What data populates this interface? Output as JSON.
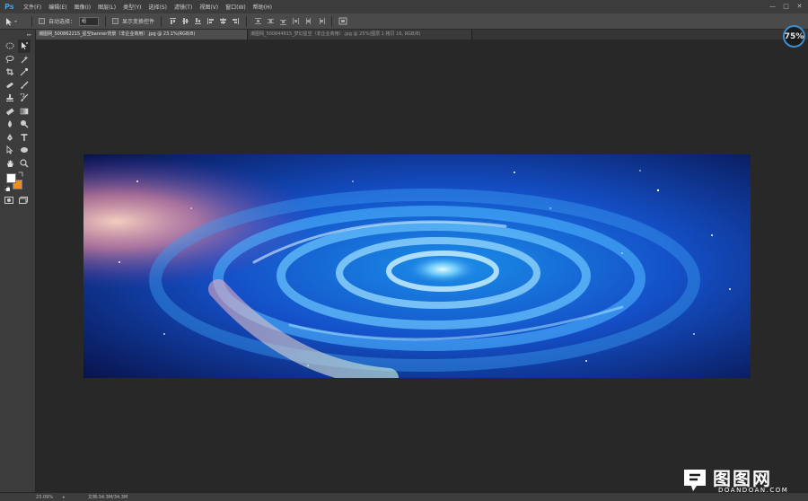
{
  "app": {
    "logo": "Ps"
  },
  "menubar": {
    "items": [
      "文件(F)",
      "编辑(E)",
      "图像(I)",
      "图层(L)",
      "类型(Y)",
      "选择(S)",
      "滤镜(T)",
      "视图(V)",
      "窗口(W)",
      "帮助(H)"
    ]
  },
  "options": {
    "auto_select_label": "自动选择：",
    "auto_select_value": "组",
    "show_transform_label": "显示变换控件"
  },
  "zoom_gauge": {
    "label": "75%"
  },
  "tabs": [
    {
      "label": "潮图网_500862215_星空banner背景（非企业商用）.jpg @ 23.1%(RGB/8)",
      "active": true
    },
    {
      "label": "潮图网_500844815_梦幻星空（非企业商用）.jpg @ 25%(图层 1 拷贝 16, RGB/8)",
      "active": false
    }
  ],
  "tools": {
    "icons": [
      "marquee-icon",
      "move-icon",
      "lasso-icon",
      "magic-wand-icon",
      "crop-icon",
      "eyedropper-icon",
      "healing-brush-icon",
      "brush-icon",
      "clone-stamp-icon",
      "history-brush-icon",
      "eraser-icon",
      "gradient-icon",
      "blur-icon",
      "dodge-icon",
      "pen-icon",
      "type-icon",
      "path-selection-icon",
      "shape-icon",
      "hand-icon",
      "zoom-icon"
    ]
  },
  "colors": {
    "foreground": "#ffffff",
    "background": "#f08c1a",
    "accent": "#3b8fd0"
  },
  "status": {
    "zoom": "23.09%",
    "doc_info": "文档:34.3M/34.3M"
  },
  "watermark": {
    "text": "图图网",
    "sub": "DOANDOAN.COM"
  }
}
